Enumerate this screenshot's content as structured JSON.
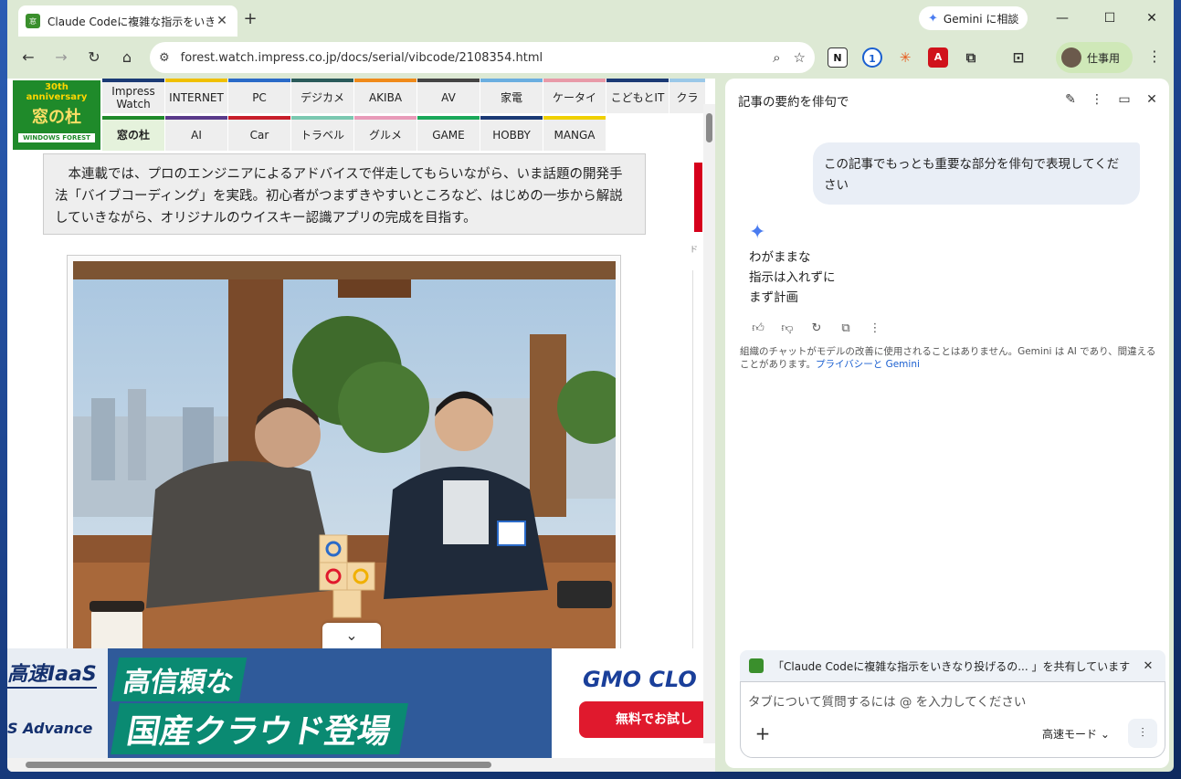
{
  "browser": {
    "tab_title": "Claude Codeに複雑な指示をいき",
    "tab_favicon": "窓",
    "new_tab": "+",
    "close_tab": "✕",
    "gemini_button": "Gemini に相談",
    "url": "forest.watch.impress.co.jp/docs/serial/vibcode/2108354.html",
    "profile_label": "仕事用",
    "window_controls": {
      "minimize": "—",
      "maximize": "☐",
      "close": "✕"
    },
    "extensions": [
      "N",
      "1",
      "✳",
      "A"
    ]
  },
  "site": {
    "logo_anniversary": "30th anniversary",
    "logo_name": "窓の杜",
    "logo_sub": "WINDOWS FOREST",
    "nav_row1": [
      "Impress Watch",
      "INTERNET",
      "PC",
      "デジカメ",
      "AKIBA",
      "AV",
      "家電",
      "ケータイ",
      "こどもとIT",
      "クラ"
    ],
    "nav_row2": [
      "窓の杜",
      "AI",
      "Car",
      "トラベル",
      "グルメ",
      "GAME",
      "HOBBY",
      "MANGA"
    ],
    "lead_text": "　本連載では、プロのエンジニアによるアドバイスで伴走してもらいながら、いま話題の開発手法「バイブコーディング」を実践。初心者がつまずきやすいところなど、はじめの一歩から解説していきながら、オリジナルのウイスキー認識アプリの完成を目指す。",
    "right_col_label": "ド"
  },
  "ad": {
    "left_top": "高速IaaS",
    "left_bottom": "S Advance",
    "headline1": "高信頼な",
    "headline2": "国産クラウド登場",
    "brand": "GMO CLO",
    "cta": "無料でお試し"
  },
  "panel": {
    "title": "記事の要約を俳句で",
    "user_message": "この記事でもっとも重要な部分を俳句で表現してください",
    "reply_lines": [
      "わがままな",
      "指示は入れずに",
      "まず計画"
    ],
    "notice_text": "組織のチャットがモデルの改善に使用されることはありません。Gemini は AI であり、間違えることがあります。",
    "notice_link": "プライバシーと Gemini",
    "share_text": "「Claude Codeに複雑な指示をいきなり投げるの... 」を共有しています",
    "input_placeholder": "タブについて質問するには @ を入力してください",
    "mode_label": "高速モード ⌄"
  },
  "colors": {
    "window_bg": "#dde9d4",
    "site_green": "#1f8a2a",
    "gemini_blue": "#4a7cf0",
    "ad_red": "#e0192d"
  }
}
